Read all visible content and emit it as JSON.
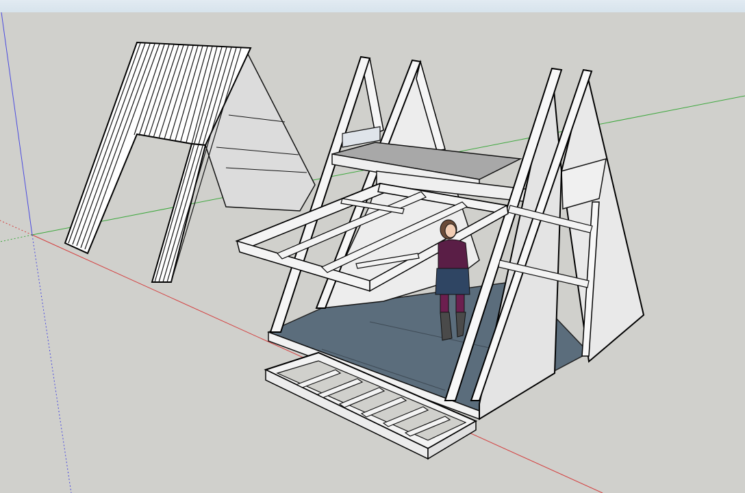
{
  "window": {
    "title_bar": ""
  },
  "viewport": {
    "background_color": "#d0d0cc",
    "axis_colors": {
      "red": "#d43c3c",
      "green": "#3ca83c",
      "blue": "#4a4ae0"
    },
    "scene_objects": [
      "corrugated-roof-panel",
      "a-frame-cabin",
      "loft-platform",
      "front-deck-frame",
      "hinged-window-frame",
      "scale-figure-person"
    ]
  }
}
